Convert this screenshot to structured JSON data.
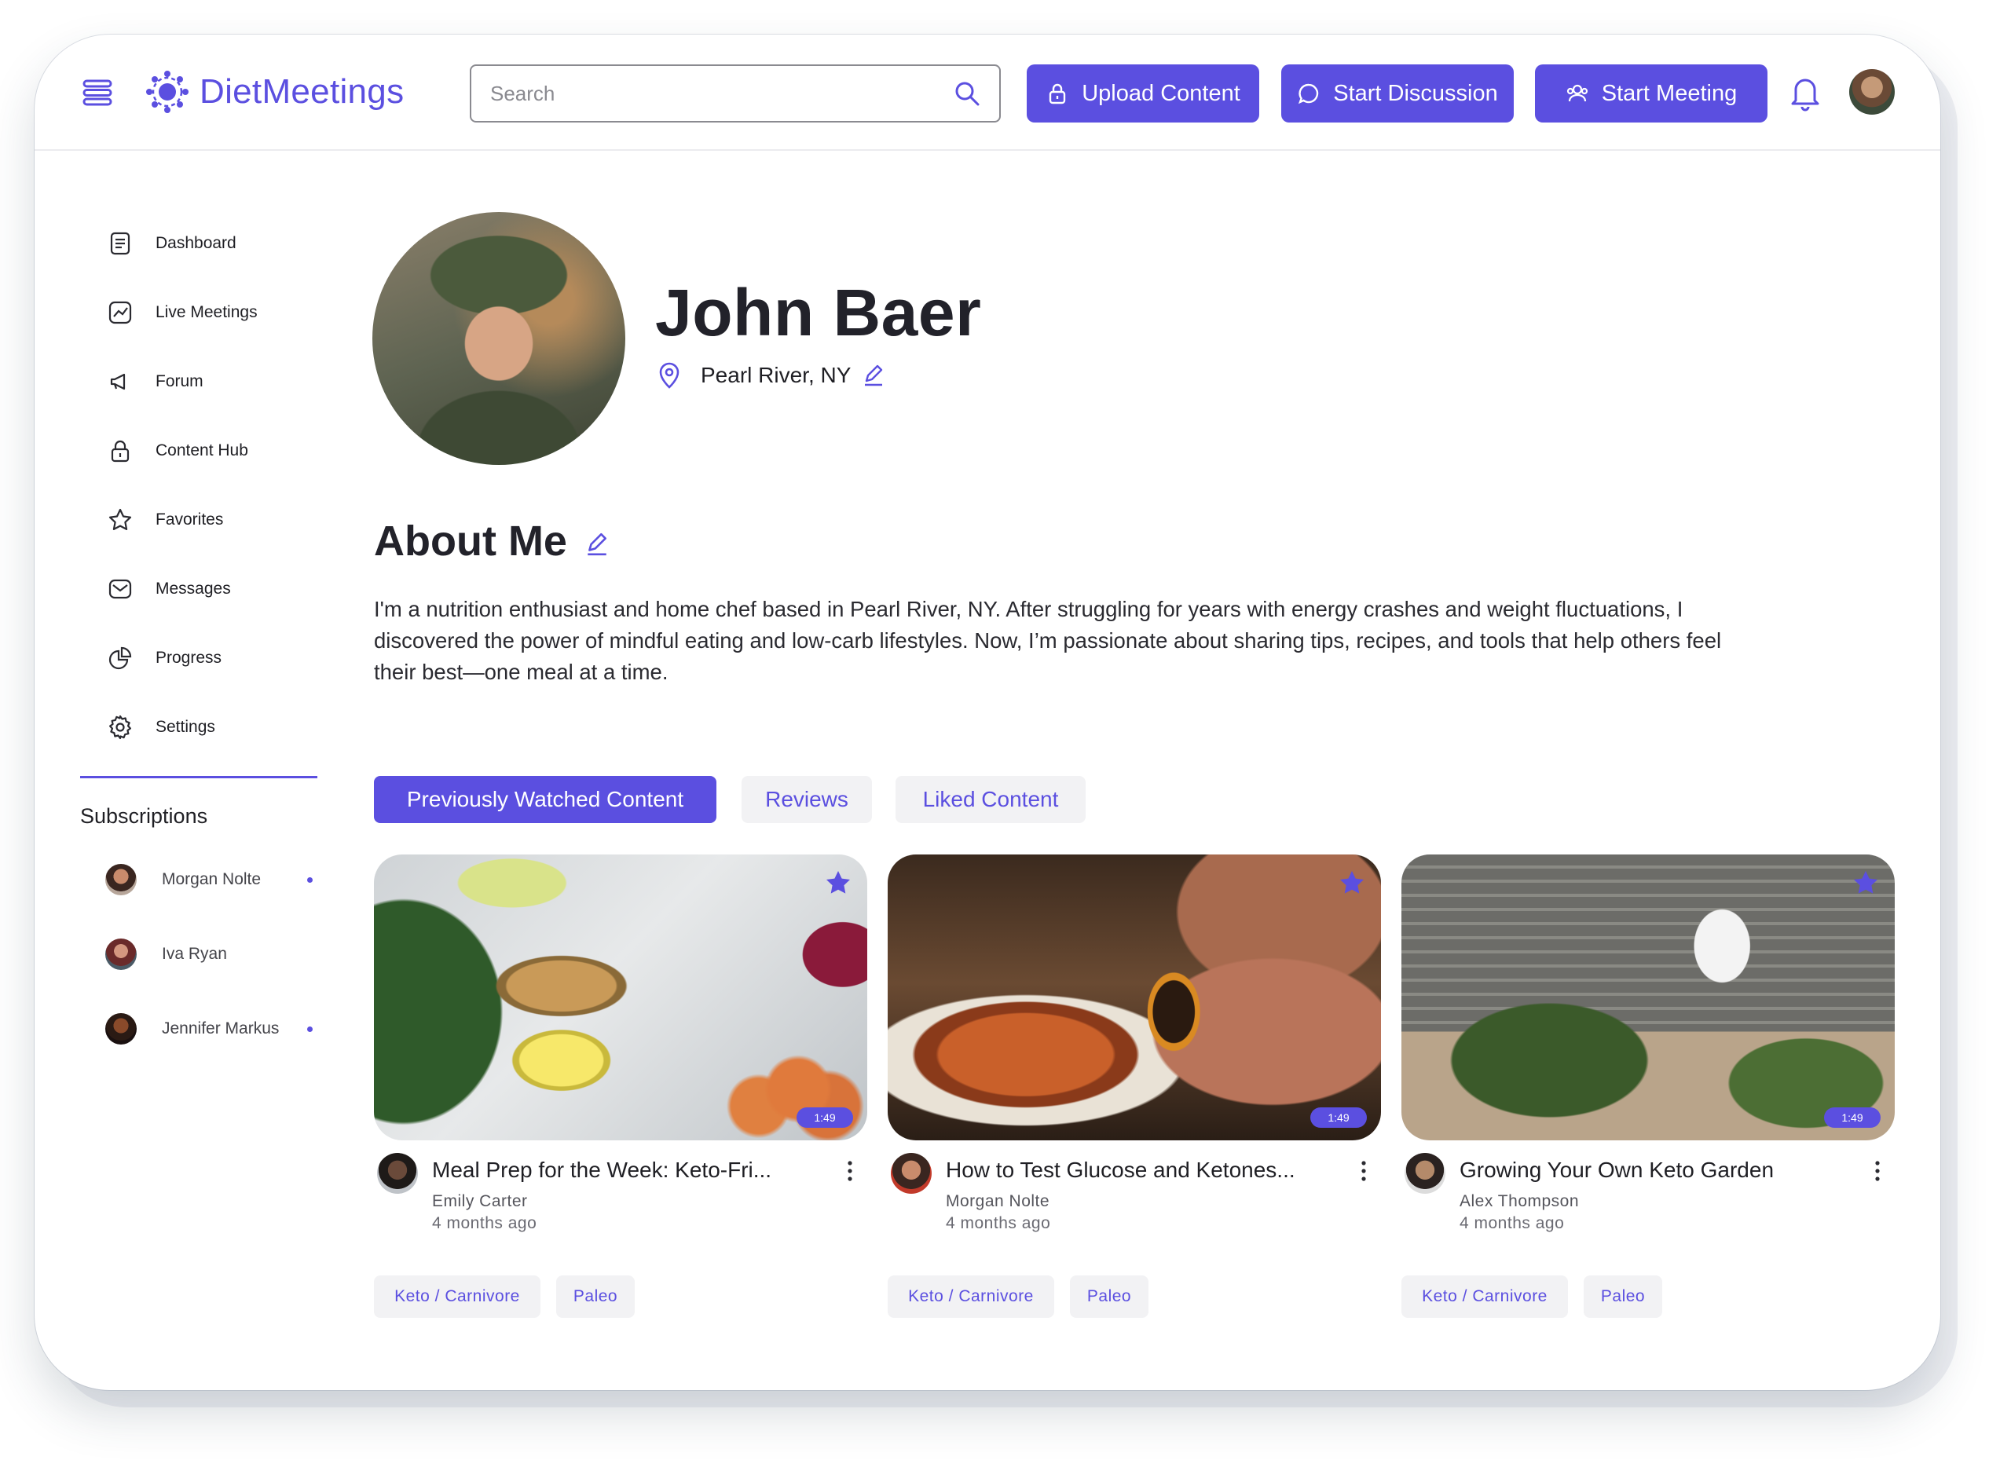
{
  "app": {
    "name": "DietMeetings",
    "accent_color": "#5b4fe0"
  },
  "header": {
    "search_placeholder": "Search",
    "buttons": {
      "upload": "Upload Content",
      "discussion": "Start Discussion",
      "meeting": "Start Meeting"
    },
    "icons": [
      "menu-icon",
      "logo-icon",
      "search-icon",
      "lock-icon",
      "chat-bubble-icon",
      "users-icon",
      "bell-icon"
    ]
  },
  "sidebar": {
    "items": [
      {
        "label": "Dashboard",
        "icon": "document-icon"
      },
      {
        "label": "Live Meetings",
        "icon": "chart-line-icon"
      },
      {
        "label": "Forum",
        "icon": "megaphone-icon"
      },
      {
        "label": "Content Hub",
        "icon": "lock-icon"
      },
      {
        "label": "Favorites",
        "icon": "star-icon"
      },
      {
        "label": "Messages",
        "icon": "mail-icon"
      },
      {
        "label": "Progress",
        "icon": "pie-chart-icon"
      },
      {
        "label": "Settings",
        "icon": "gear-icon"
      }
    ],
    "subscriptions_title": "Subscriptions",
    "subscriptions": [
      {
        "name": "Morgan Nolte",
        "unread": true
      },
      {
        "name": "Iva Ryan",
        "unread": false
      },
      {
        "name": "Jennifer Markus",
        "unread": true
      }
    ]
  },
  "profile": {
    "name": "John Baer",
    "location": "Pearl River, NY",
    "about_title": "About Me",
    "about_text": "I'm a nutrition enthusiast and home chef based in Pearl River, NY. After struggling for years with energy crashes and weight fluctuations, I discovered the power of mindful eating and low-carb lifestyles. Now, I’m passionate about sharing tips, recipes, and tools that help others feel their best—one meal at a time."
  },
  "tabs": [
    {
      "label": "Previously Watched Content",
      "active": true
    },
    {
      "label": "Reviews",
      "active": false
    },
    {
      "label": "Liked Content",
      "active": false
    }
  ],
  "cards": [
    {
      "title": "Meal Prep for the Week: Keto-Fri...",
      "author": "Emily Carter",
      "age": "4 months ago",
      "duration": "1:49",
      "tags": [
        "Keto / Carnivore",
        "Paleo"
      ]
    },
    {
      "title": "How to Test Glucose and Ketones...",
      "author": "Morgan Nolte",
      "age": "4 months ago",
      "duration": "1:49",
      "tags": [
        "Keto / Carnivore",
        "Paleo"
      ]
    },
    {
      "title": "Growing Your Own Keto Garden",
      "author": "Alex Thompson",
      "age": "4 months ago",
      "duration": "1:49",
      "tags": [
        "Keto / Carnivore",
        "Paleo"
      ]
    }
  ]
}
